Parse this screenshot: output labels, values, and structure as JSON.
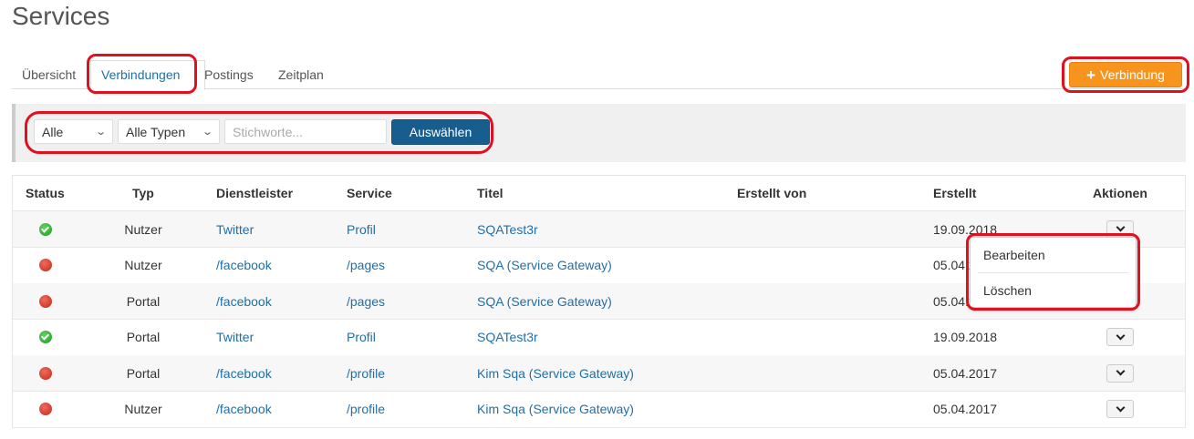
{
  "page": {
    "title": "Services"
  },
  "tabs": [
    {
      "label": "Übersicht"
    },
    {
      "label": "Verbindungen"
    },
    {
      "label": "Postings"
    },
    {
      "label": "Zeitplan"
    }
  ],
  "actions": {
    "add_connection": "Verbindung",
    "add_icon": "plus-icon"
  },
  "filters": {
    "status_value": "Alle",
    "type_value": "Alle Typen",
    "keyword_placeholder": "Stichworte...",
    "apply_label": "Auswählen"
  },
  "table": {
    "columns": [
      "Status",
      "Typ",
      "Dienstleister",
      "Service",
      "Titel",
      "Erstellt von",
      "Erstellt",
      "Aktionen"
    ],
    "rows": [
      {
        "status": "ok",
        "typ": "Nutzer",
        "dienstleister": "Twitter",
        "service": "Profil",
        "titel": "SQATest3r",
        "erstellt_von": "",
        "erstellt": "19.09.2018"
      },
      {
        "status": "error",
        "typ": "Nutzer",
        "dienstleister": "/facebook",
        "service": "/pages",
        "titel": "SQA (Service Gateway)",
        "erstellt_von": "",
        "erstellt": "05.04.2017"
      },
      {
        "status": "error",
        "typ": "Portal",
        "dienstleister": "/facebook",
        "service": "/pages",
        "titel": "SQA (Service Gateway)",
        "erstellt_von": "",
        "erstellt": "05.04.2017"
      },
      {
        "status": "ok",
        "typ": "Portal",
        "dienstleister": "Twitter",
        "service": "Profil",
        "titel": "SQATest3r",
        "erstellt_von": "",
        "erstellt": "19.09.2018"
      },
      {
        "status": "error",
        "typ": "Portal",
        "dienstleister": "/facebook",
        "service": "/profile",
        "titel": "Kim Sqa (Service Gateway)",
        "erstellt_von": "",
        "erstellt": "05.04.2017"
      },
      {
        "status": "error",
        "typ": "Nutzer",
        "dienstleister": "/facebook",
        "service": "/profile",
        "titel": "Kim Sqa (Service Gateway)",
        "erstellt_von": "",
        "erstellt": "05.04.2017"
      }
    ]
  },
  "row_menu": {
    "items": [
      "Bearbeiten",
      "Löschen"
    ]
  },
  "colors": {
    "link": "#1f6fa8",
    "accent_orange": "#f7941d",
    "primary_button": "#175e8f",
    "status_ok": "#2db52d",
    "status_error": "#d9362a",
    "annotation": "#e0101e"
  }
}
